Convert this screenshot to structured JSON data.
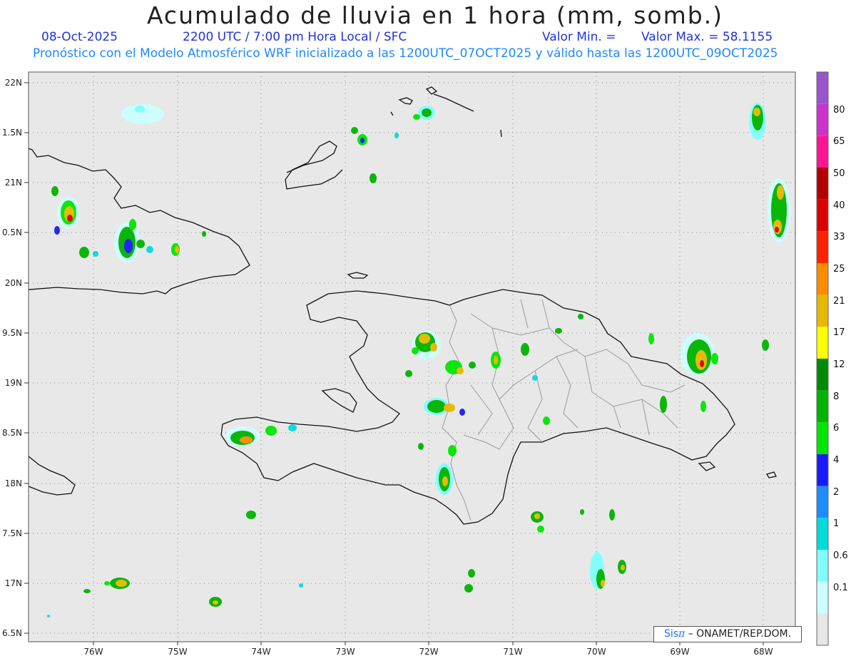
{
  "header": {
    "title": "Acumulado de lluvia en 1 hora (mm, somb.)",
    "date": "08-Oct-2025",
    "valid_time": "2200 UTC / 7:00 pm Hora Local / SFC",
    "valor_min": "Valor Min. =",
    "valor_max": "Valor Max. = 58.1155",
    "model_info": "Pronóstico con el Modelo Atmosférico WRF inicializado a las 1200UTC_07OCT2025 y válido hasta las  1200UTC_09OCT2025"
  },
  "axes": {
    "lat_labels": [
      "22N",
      "1.5N",
      "21N",
      "0.5N",
      "20N",
      "9.5N",
      "19N",
      "8.5N",
      "18N",
      "7.5N",
      "17N",
      "6.5N"
    ],
    "lon_labels": [
      "76W",
      "75W",
      "74W",
      "73W",
      "72W",
      "71W",
      "70W",
      "69W",
      "68W"
    ]
  },
  "colorbar": {
    "labels": [
      "80",
      "65",
      "50",
      "40",
      "33",
      "25",
      "21",
      "17",
      "12",
      "8",
      "6",
      "4",
      "2",
      "1",
      "0.6",
      "0.1"
    ],
    "colors": [
      "#9a55cc",
      "#cc33cc",
      "#ff1493",
      "#b40000",
      "#dd0000",
      "#ff2200",
      "#ff8c00",
      "#e6b800",
      "#ffff00",
      "#008a00",
      "#00b400",
      "#00e600",
      "#1a1aff",
      "#1e8cff",
      "#00dcdc",
      "#80ffff",
      "#ccffff",
      "#e6e6e6"
    ]
  },
  "credit": {
    "sis": "Sis",
    "pi": "π",
    "text": "– ONAMET/REP.DOM."
  }
}
